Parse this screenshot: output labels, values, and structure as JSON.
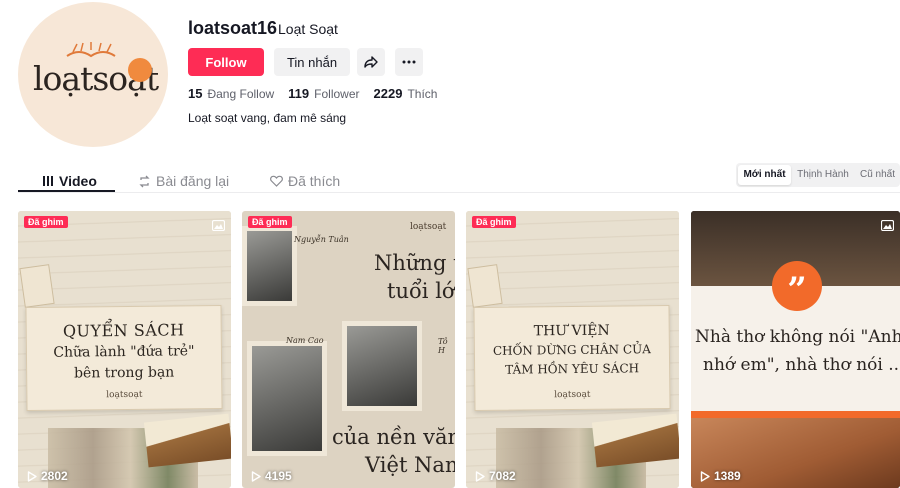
{
  "profile": {
    "username": "loatsoat16",
    "nickname": "Loạt Soạt",
    "avatar_text": "loạtsoạt",
    "follow_label": "Follow",
    "message_label": "Tin nhắn",
    "stats": {
      "following_count": "15",
      "following_label": "Đang Follow",
      "followers_count": "119",
      "followers_label": "Follower",
      "likes_count": "2229",
      "likes_label": "Thích"
    },
    "bio": "Loạt soạt vang, đam mê sáng"
  },
  "tabs": [
    {
      "label": "Video",
      "icon": "grid-bars-icon",
      "active": true
    },
    {
      "label": "Bài đăng lại",
      "icon": "repost-icon",
      "active": false
    },
    {
      "label": "Đã thích",
      "icon": "heart-outline-icon",
      "active": false
    }
  ],
  "sort": {
    "options": [
      "Mới nhất",
      "Thịnh Hành",
      "Cũ nhất"
    ],
    "selected": "Mới nhất"
  },
  "videos": [
    {
      "pinned_label": "Đã ghim",
      "views": "2802",
      "lines": [
        "QUYỂN SÁCH",
        "Chữa lành \"đứa trẻ\"",
        "bên trong bạn"
      ],
      "logo": "loạtsoạt"
    },
    {
      "pinned_label": "Đã ghim",
      "views": "4195",
      "logo": "loạtsoạt",
      "names": [
        "Nguyễn Tuân",
        "Nam Cao",
        "Tô H"
      ],
      "lines": [
        "Những tá",
        "tuổi lớn",
        "của nền văn h",
        "Việt Nam"
      ]
    },
    {
      "pinned_label": "Đã ghim",
      "views": "7082",
      "lines": [
        "THƯ VIỆN",
        "CHỐN DỪNG CHÂN CỦA",
        "TÂM HỒN YÊU SÁCH"
      ],
      "logo": "loạtsoạt"
    },
    {
      "views": "1389",
      "lines": [
        "Nhà thơ không nói \"Anh",
        "nhớ em\", nhà thơ nói ..."
      ],
      "quote_mark": "”"
    }
  ],
  "colors": {
    "accent": "#fe2c55",
    "text": "#161823",
    "muted": "#5e606a",
    "quote_orange": "#f26a2a"
  }
}
